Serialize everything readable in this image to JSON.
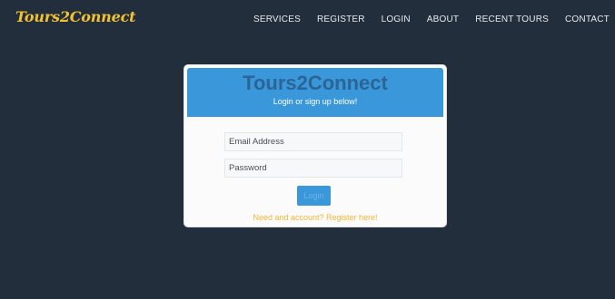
{
  "navbar": {
    "brand": "Tours2Connect",
    "links": [
      "SERVICES",
      "REGISTER",
      "LOGIN",
      "ABOUT",
      "RECENT TOURS",
      "CONTACT"
    ]
  },
  "login_card": {
    "title": "Tours2Connect",
    "subtitle": "Login or sign up below!",
    "email_placeholder": "Email Address",
    "password_placeholder": "Password",
    "login_button": "Login",
    "register_link": "Need and account? Register here!"
  },
  "colors": {
    "background": "#222e3c",
    "brand": "#f2c230",
    "card_header": "#3a97d9",
    "title_text": "#2b6496",
    "link": "#f2b531"
  }
}
